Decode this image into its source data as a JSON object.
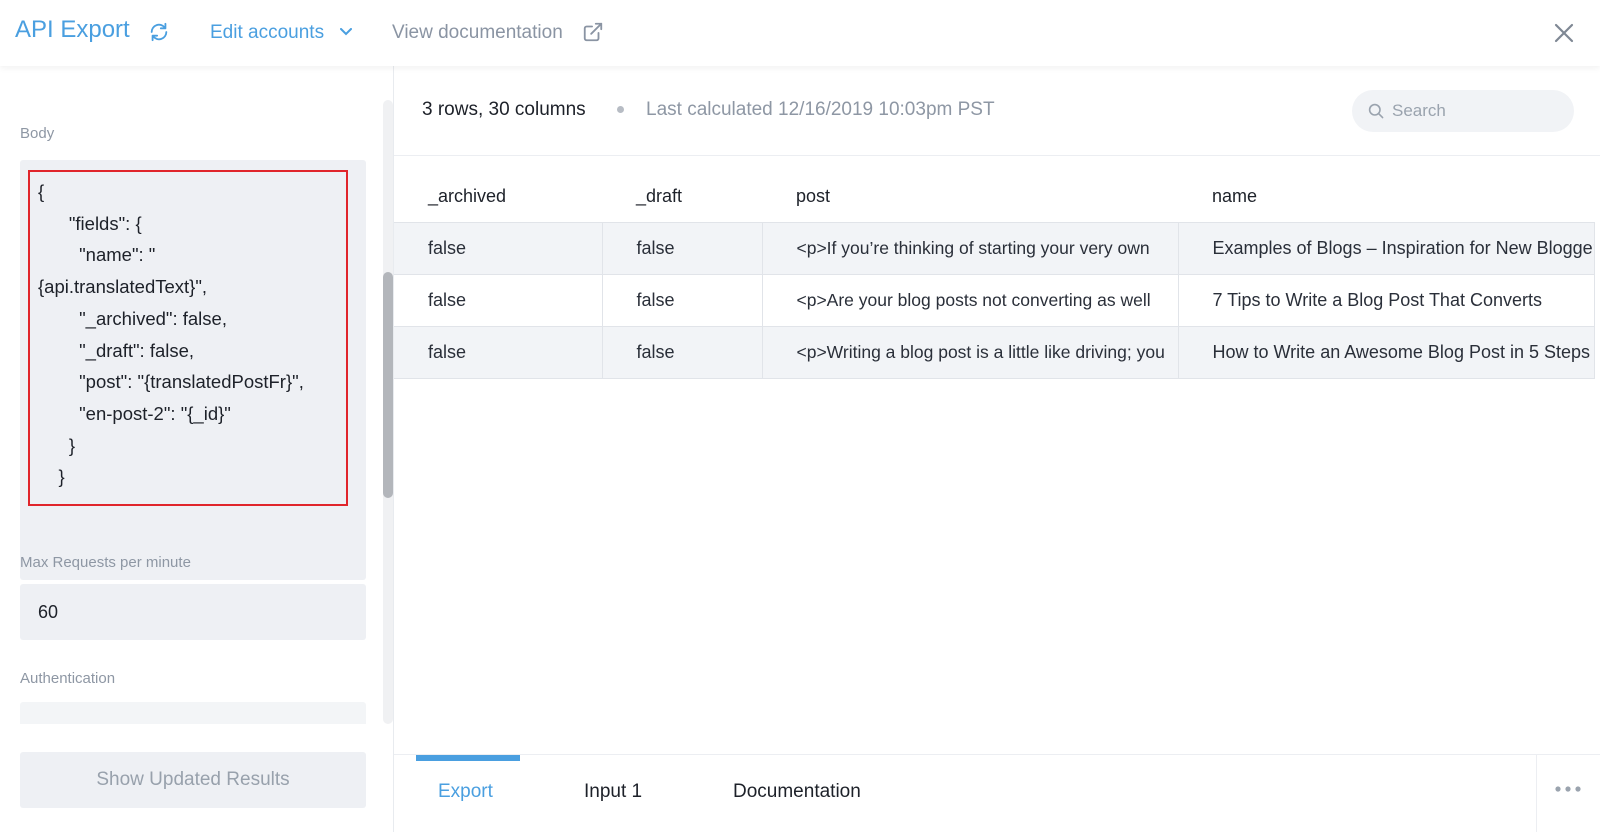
{
  "header": {
    "title": "API Export",
    "edit_accounts": "Edit accounts",
    "view_documentation": "View documentation"
  },
  "left": {
    "body_label": "Body",
    "body_lines": [
      "{",
      "      \"fields\": {",
      "        \"name\": \"",
      "{api.translatedText}\",",
      "        \"_archived\": false,",
      "        \"_draft\": false,",
      "        \"post\": \"{translatedPostFr}\",",
      "        \"en-post-2\": \"{_id}\"",
      "      }",
      "    }"
    ],
    "max_requests_label": "Max Requests per minute",
    "max_requests_value": "60",
    "authentication_label": "Authentication",
    "show_updated_button": "Show Updated Results"
  },
  "results": {
    "summary": "3 rows, 30 columns",
    "last_calculated": "Last calculated 12/16/2019 10:03pm PST",
    "search_placeholder": "Search",
    "columns": [
      "_archived",
      "_draft",
      "post",
      "name"
    ],
    "rows": [
      [
        "false",
        "false",
        "<p>If you’re thinking of starting your very own",
        "Examples of Blogs – Inspiration for New Bloggers"
      ],
      [
        "false",
        "false",
        "<p>Are your blog posts not converting as well",
        "7 Tips to Write a Blog Post That Converts"
      ],
      [
        "false",
        "false",
        "<p>Writing a blog post is a little like driving; you",
        "How to Write an Awesome Blog Post in 5 Steps"
      ]
    ]
  },
  "tabs": [
    {
      "label": "Export",
      "active": true
    },
    {
      "label": "Input 1",
      "active": false
    },
    {
      "label": "Documentation",
      "active": false
    }
  ],
  "colors": {
    "accent": "#4a9fe0",
    "highlight_border": "#e0252b",
    "muted_text": "#8e97a4"
  },
  "icons": [
    "refresh-icon",
    "chevron-down-icon",
    "external-link-icon",
    "close-icon",
    "search-icon",
    "more-icon"
  ]
}
